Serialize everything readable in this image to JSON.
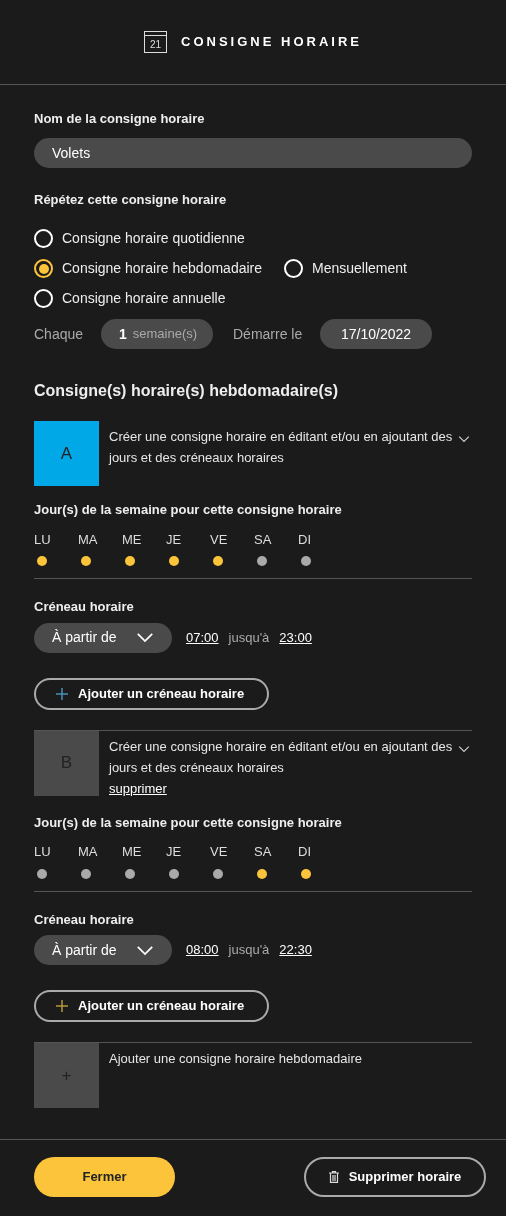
{
  "header": {
    "title": "CONSIGNE HORAIRE",
    "icon_day": "21"
  },
  "name_field": {
    "label": "Nom de la consigne horaire",
    "value": "Volets"
  },
  "repeat": {
    "label": "Répétez cette consigne horaire",
    "rows": [
      [
        {
          "label": "Consigne horaire quotidienne",
          "selected": false
        }
      ],
      [
        {
          "label": "Consigne horaire hebdomadaire",
          "selected": true
        },
        {
          "label": "Mensuellement",
          "selected": false
        }
      ],
      [
        {
          "label": "Consigne horaire annuelle",
          "selected": false
        }
      ]
    ]
  },
  "interval": {
    "label": "Chaque",
    "value": "1",
    "unit": "semaine(s)",
    "start_label": "Démarre le",
    "start_date": "17/10/2022"
  },
  "schedules_heading": "Consigne(s) horaire(s) hebdomadaire(s)",
  "schedules": [
    {
      "letter": "A",
      "color": "#00a8e8",
      "description": "Créer une consigne horaire en éditant et/ou en ajoutant des jours et des créneaux horaires",
      "days_label": "Jour(s) de la semaine pour cette consigne horaire",
      "days": [
        {
          "label": "LU",
          "selected": true
        },
        {
          "label": "MA",
          "selected": true
        },
        {
          "label": "ME",
          "selected": true
        },
        {
          "label": "JE",
          "selected": true
        },
        {
          "label": "VE",
          "selected": true
        },
        {
          "label": "SA",
          "selected": false
        },
        {
          "label": "DI",
          "selected": false
        }
      ],
      "slot_label": "Créneau horaire",
      "slot_mode": "À partir de",
      "from": "07:00",
      "until": "jusqu'à",
      "to": "23:00",
      "add_slot": "Ajouter un créneau horaire"
    },
    {
      "letter": "B",
      "color": "#4a4a4a",
      "description": "Créer une consigne horaire en éditant et/ou en ajoutant des jours et des créneaux horaires",
      "delete_link": "supprimer",
      "days_label": "Jour(s) de la semaine pour cette consigne horaire",
      "days": [
        {
          "label": "LU",
          "selected": false
        },
        {
          "label": "MA",
          "selected": false
        },
        {
          "label": "ME",
          "selected": false
        },
        {
          "label": "JE",
          "selected": false
        },
        {
          "label": "VE",
          "selected": false
        },
        {
          "label": "SA",
          "selected": true
        },
        {
          "label": "DI",
          "selected": true
        }
      ],
      "slot_label": "Créneau horaire",
      "slot_mode": "À partir de",
      "from": "08:00",
      "until": "jusqu'à",
      "to": "22:30",
      "add_slot": "Ajouter un créneau horaire"
    }
  ],
  "add_schedule": {
    "symbol": "+",
    "label": "Ajouter une consigne horaire hebdomadaire"
  },
  "footer": {
    "close": "Fermer",
    "delete": "Supprimer horaire"
  }
}
